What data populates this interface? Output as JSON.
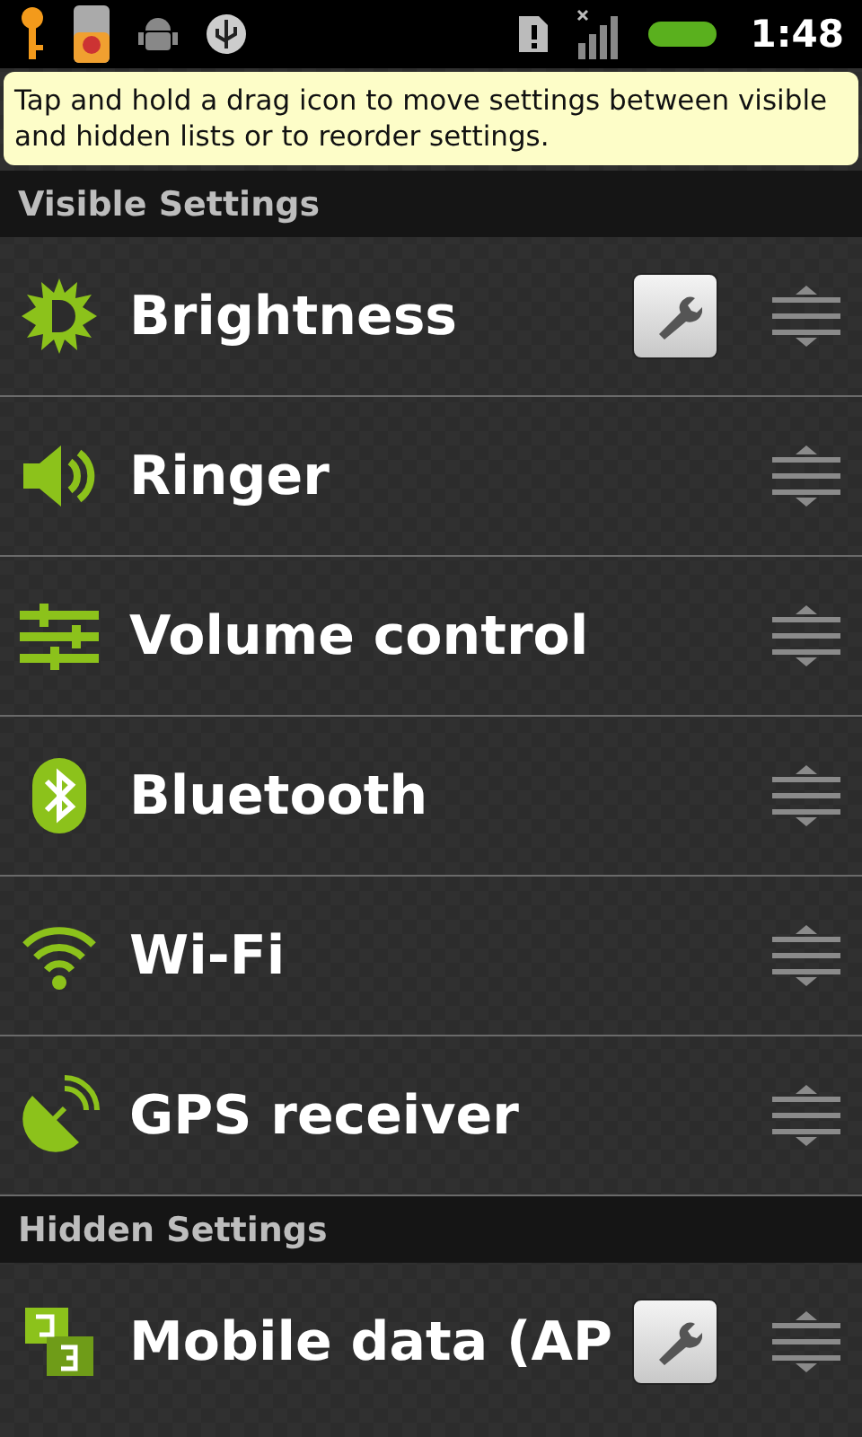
{
  "status_bar": {
    "time": "1:48"
  },
  "hint": "Tap and hold a drag icon to move settings between visible and hidden lists or to reorder settings.",
  "sections": [
    {
      "title": "Visible Settings",
      "items": [
        {
          "label": "Brightness",
          "kind": "brightness",
          "configurable": true
        },
        {
          "label": "Ringer",
          "kind": "ringer",
          "configurable": false
        },
        {
          "label": "Volume control",
          "kind": "sliders",
          "configurable": false
        },
        {
          "label": "Bluetooth",
          "kind": "bluetooth",
          "configurable": false
        },
        {
          "label": "Wi-Fi",
          "kind": "wifi",
          "configurable": false
        },
        {
          "label": "GPS receiver",
          "kind": "gps",
          "configurable": false
        }
      ]
    },
    {
      "title": "Hidden Settings",
      "items": [
        {
          "label": "Mobile data (AP",
          "kind": "mobile",
          "configurable": true
        }
      ]
    }
  ]
}
